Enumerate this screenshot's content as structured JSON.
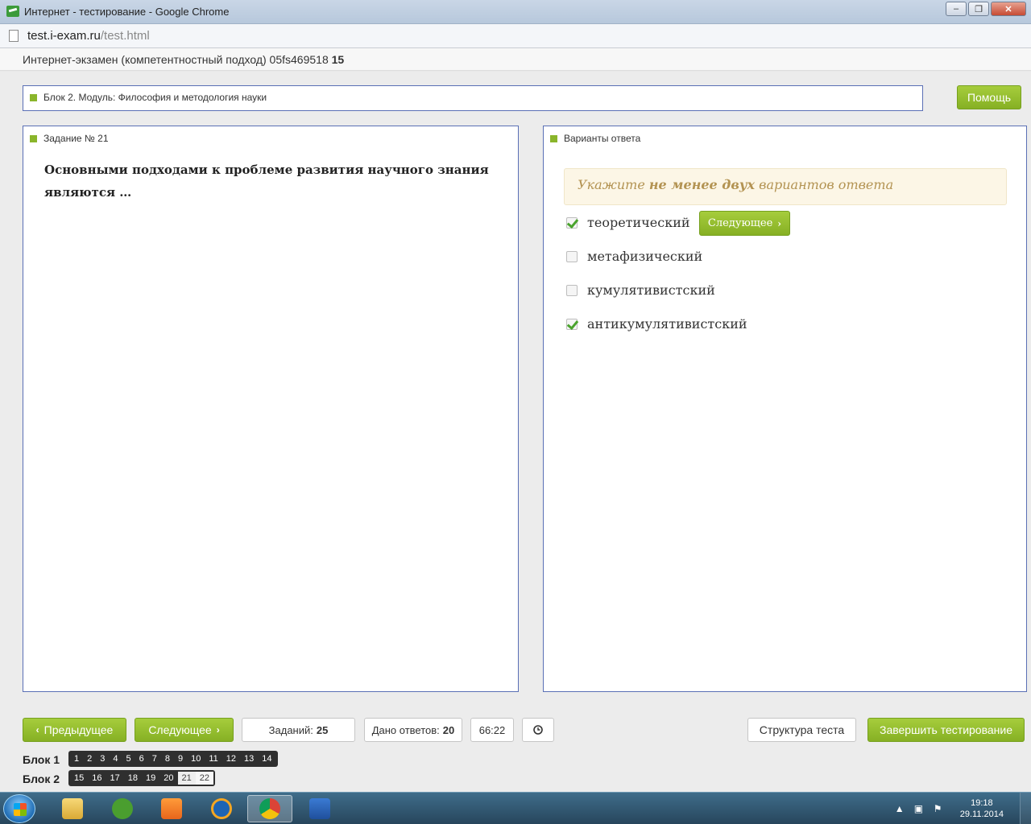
{
  "window": {
    "title": "Интернет - тестирование - Google Chrome",
    "minimize": "–",
    "restore": "❐",
    "close": "✕"
  },
  "address": {
    "host": "test.i-exam.ru",
    "path": "/test.html"
  },
  "exam_header": {
    "text": "Интернет-экзамен (компетентностный подход) 05fs469518",
    "number": "15"
  },
  "module": {
    "label": "Блок 2. Модуль: Философия и методология науки"
  },
  "help_button": "Помощь",
  "task": {
    "heading": "Задание № 21",
    "question": "Основными подходами к проблеме развития научного знания являются …"
  },
  "answers": {
    "heading": "Варианты ответа",
    "hint_prefix": "Укажите",
    "hint_bold": "не менее двух",
    "hint_suffix": "вариантов ответа",
    "next_inline": "Следующее",
    "options": [
      {
        "label": "теоретический",
        "checked": true
      },
      {
        "label": "метафизический",
        "checked": false
      },
      {
        "label": "кумулятивистский",
        "checked": false
      },
      {
        "label": "антикумулятивистский",
        "checked": true
      }
    ]
  },
  "footer": {
    "prev": "Предыдущее",
    "next": "Следующее",
    "tasks_label": "Заданий:",
    "tasks_value": "25",
    "answered_label": "Дано ответов:",
    "answered_value": "20",
    "timer": "66:22",
    "clock_icon": "clock-icon",
    "structure": "Структура теста",
    "finish": "Завершить тестирование"
  },
  "blocks": [
    {
      "label": "Блок 1",
      "items": [
        "1",
        "2",
        "3",
        "4",
        "5",
        "6",
        "7",
        "8",
        "9",
        "10",
        "11",
        "12",
        "13",
        "14"
      ]
    },
    {
      "label": "Блок 2",
      "items": [
        "15",
        "16",
        "17",
        "18",
        "19",
        "20",
        "21",
        "22"
      ]
    }
  ],
  "taskbar": {
    "time": "19:18",
    "date": "29.11.2014"
  }
}
